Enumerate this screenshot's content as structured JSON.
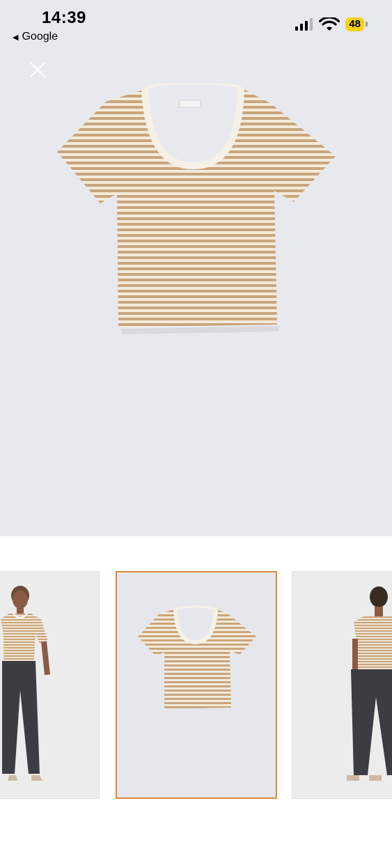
{
  "status_bar": {
    "time": "14:39",
    "back_label": "Google",
    "battery": "48"
  },
  "product_images": [
    {
      "name": "model-front"
    },
    {
      "name": "shirt-flat",
      "selected": true
    },
    {
      "name": "model-back"
    }
  ],
  "colors": {
    "stripe": "#c9a57c",
    "base": "#f3ebdb",
    "trim": "#f5f1e6",
    "selected_border": "#d98a3a",
    "pants": "#3b3d42"
  }
}
